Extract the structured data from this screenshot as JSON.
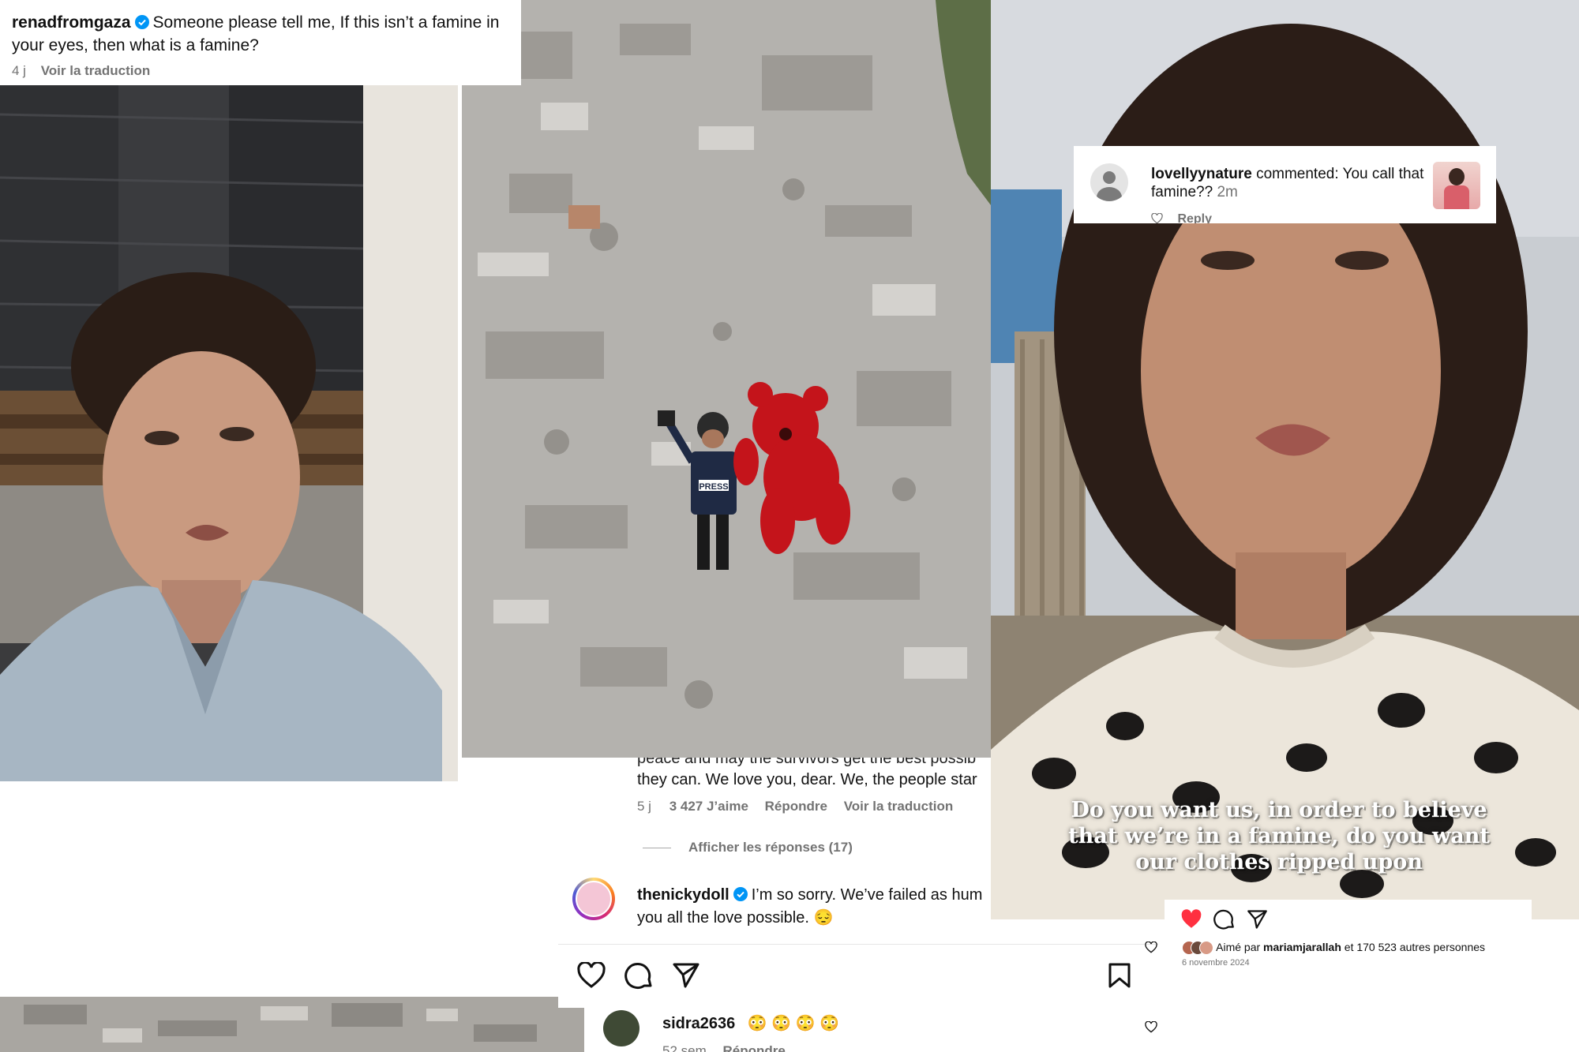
{
  "comment_top": {
    "username": "renadfromgaza",
    "text": "Someone please tell me, If this isn’t a famine in your eyes, then what is a famine?",
    "age": "4 j",
    "translate": "Voir la traduction"
  },
  "comment_middle": {
    "text_partial": "peace and may the survivors get the best possib",
    "text_line2": "they can. We love you, dear. We, the people star",
    "age": "5 j",
    "likes": "3 427 J’aime",
    "reply": "Répondre",
    "translate": "Voir la traduction",
    "show_replies": "Afficher les réponses (17)"
  },
  "comment_nicky": {
    "username": "thenickydoll",
    "text_line1": "I’m so sorry. We’ve failed as hum",
    "text_line2": "you all the love possible. 😔"
  },
  "comment_sidra": {
    "username": "sidra2636",
    "text": "😳 😳 😳 😳",
    "age": "52 sem",
    "reply": "Répondre"
  },
  "notification": {
    "username": "lovellyynature",
    "text": "commented: You call that famine??",
    "time": "2m",
    "reply": "Reply"
  },
  "video_caption": [
    "Do you want us, in order to believe",
    "that we’re in a famine, do you want",
    "our clothes ripped upon"
  ],
  "post_footer": {
    "liked_prefix": "Aimé par",
    "liked_user": "mariamjarallah",
    "liked_suffix": "et 170 523 autres personnes",
    "date_partial": "6 novembre 2024"
  },
  "photo_labels": {
    "press_vest": "PRESS"
  },
  "colors": {
    "verified_blue": "#0095f6",
    "like_red": "#ff3040",
    "meta_gray": "#737373",
    "bear_red": "#c4141b"
  }
}
